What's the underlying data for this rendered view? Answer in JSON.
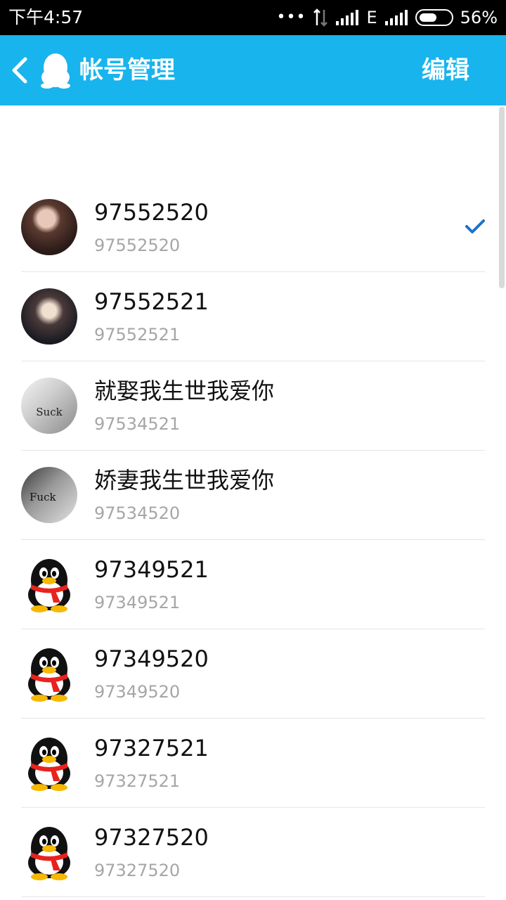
{
  "status_bar": {
    "time": "下午4:57",
    "network": "E",
    "battery_pct_text": "56%",
    "battery_level": 0.56
  },
  "header": {
    "back_icon": "chevron-left-icon",
    "logo_icon": "qq-penguin-icon",
    "title": "帐号管理",
    "edit_label": "编辑",
    "background_color": "#18b4ed"
  },
  "accounts": [
    {
      "name": "97552520",
      "qq": "97552520",
      "avatar": "photo-a",
      "avatar_caption": "",
      "selected": true
    },
    {
      "name": "97552521",
      "qq": "97552521",
      "avatar": "photo-b",
      "avatar_caption": "",
      "selected": false
    },
    {
      "name": "就娶我生世我爱你",
      "qq": "97534521",
      "avatar": "photo-c",
      "avatar_caption": "Suck",
      "selected": false
    },
    {
      "name": "娇妻我生世我爱你",
      "qq": "97534520",
      "avatar": "photo-d",
      "avatar_caption": "Fuck",
      "selected": false
    },
    {
      "name": "97349521",
      "qq": "97349521",
      "avatar": "penguin",
      "avatar_caption": "",
      "selected": false
    },
    {
      "name": "97349520",
      "qq": "97349520",
      "avatar": "penguin",
      "avatar_caption": "",
      "selected": false
    },
    {
      "name": "97327521",
      "qq": "97327521",
      "avatar": "penguin",
      "avatar_caption": "",
      "selected": false
    },
    {
      "name": "97327520",
      "qq": "97327520",
      "avatar": "penguin",
      "avatar_caption": "",
      "selected": false
    }
  ],
  "check_icon": "checkmark-icon",
  "accent_color": "#1a73c9"
}
